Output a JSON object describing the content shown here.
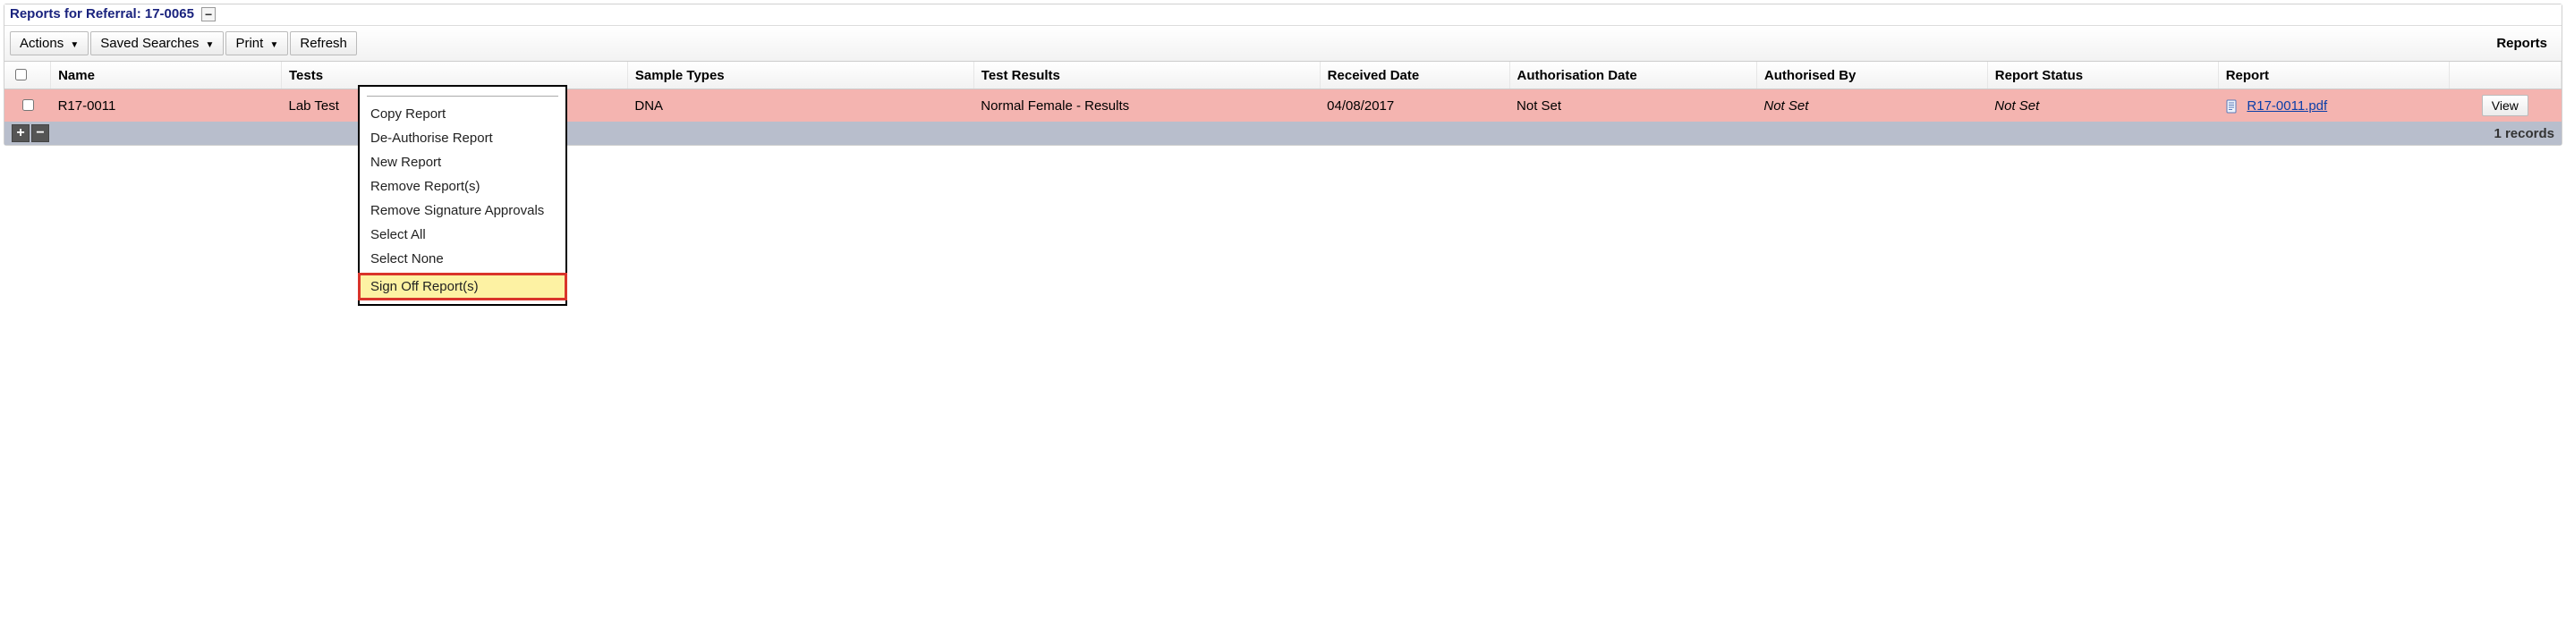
{
  "panel_title": "Reports for Referral: 17-0065",
  "toolbar": {
    "actions": "Actions",
    "saved_searches": "Saved Searches",
    "print": "Print",
    "refresh": "Refresh",
    "right_label": "Reports"
  },
  "columns": {
    "name": "Name",
    "tests": "Tests",
    "sample_types": "Sample Types",
    "test_results": "Test Results",
    "received_date": "Received Date",
    "auth_date": "Authorisation Date",
    "auth_by": "Authorised By",
    "report_status": "Report Status",
    "report": "Report"
  },
  "rows": [
    {
      "name": "R17-0011",
      "tests": "Lab Test",
      "sample_types": "DNA",
      "test_results": "Normal Female - Results",
      "received_date": "04/08/2017",
      "auth_date": "Not Set",
      "auth_by": "Not Set",
      "report_status": "Not Set",
      "report_file": "R17-0011.pdf",
      "view_label": "View"
    }
  ],
  "footer": {
    "records": "1 records"
  },
  "context_menu": {
    "items": [
      "Copy Report",
      "De-Authorise Report",
      "New Report",
      "Remove Report(s)",
      "Remove Signature Approvals",
      "Select All",
      "Select None",
      "Sign Off Report(s)"
    ],
    "highlight_index": 7
  }
}
